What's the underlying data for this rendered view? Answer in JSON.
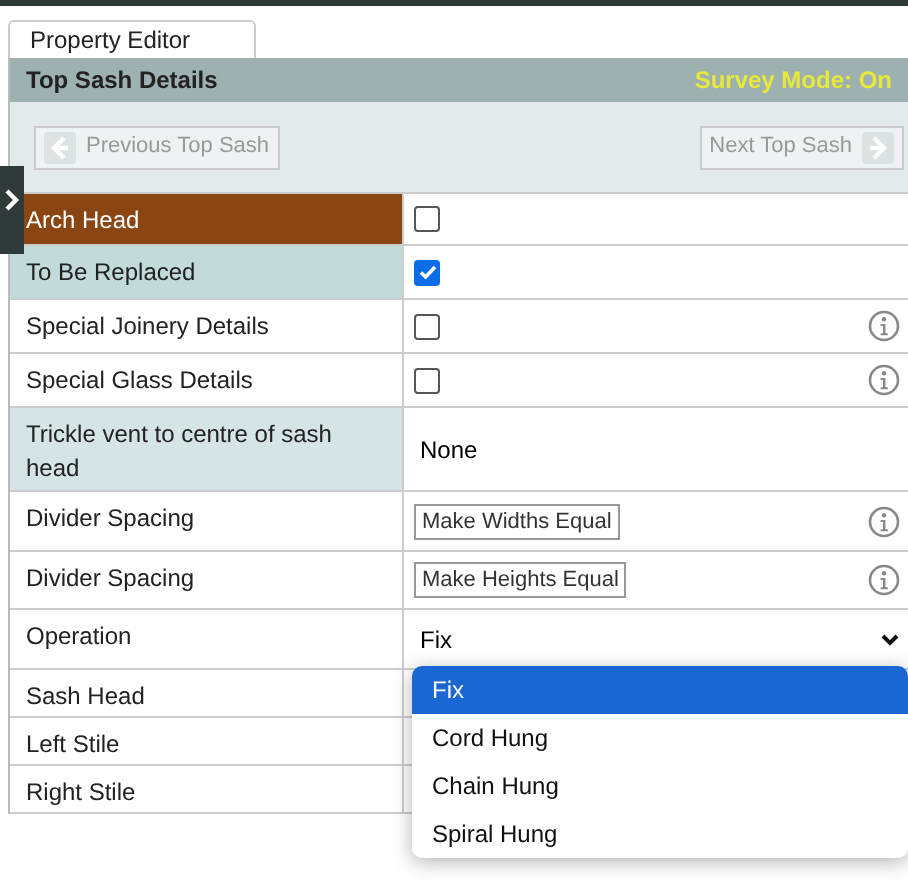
{
  "tab": {
    "label": "Property Editor",
    "selected": true
  },
  "header": {
    "title": "Top Sash Details",
    "mode": "Survey Mode: On"
  },
  "nav": {
    "previous": {
      "label": "Previous Top Sash",
      "disabled": true
    },
    "next": {
      "label": "Next Top Sash",
      "disabled": true
    }
  },
  "rows": [
    {
      "label": "Arch Head",
      "color": "#8b4513",
      "kind": "checkbox",
      "checked": false,
      "info": false
    },
    {
      "label": "To Be Replaced",
      "color": "#c2dada",
      "kind": "checkbox",
      "checked": true,
      "info": false
    },
    {
      "label": "Special Joinery Details",
      "color": "#ffffff",
      "kind": "checkbox",
      "checked": false,
      "info": true
    },
    {
      "label": "Special Glass Details",
      "color": "#ffffff",
      "kind": "checkbox",
      "checked": false,
      "info": true
    },
    {
      "label": "Trickle vent to centre of sash head",
      "color": "#d5e5e5",
      "kind": "text",
      "value": "None",
      "info": false
    },
    {
      "label": "Divider Spacing",
      "color": "#ffffff",
      "kind": "button",
      "value": "Make Widths Equal",
      "info": true
    },
    {
      "label": "Divider Spacing",
      "color": "#ffffff",
      "kind": "button",
      "value": "Make Heights Equal",
      "info": true
    },
    {
      "label": "Operation",
      "color": "#ffffff",
      "kind": "select",
      "value": "Fix",
      "info": false
    },
    {
      "label": "Sash Head",
      "color": "#ffffff",
      "kind": "hidden"
    },
    {
      "label": "Left Stile",
      "color": "#ffffff",
      "kind": "hidden"
    },
    {
      "label": "Right Stile",
      "color": "#ffffff",
      "kind": "hidden"
    }
  ],
  "dropdown": {
    "options": [
      {
        "label": "Fix",
        "selected": true
      },
      {
        "label": "Cord Hung",
        "selected": false
      },
      {
        "label": "Chain Hung",
        "selected": false
      },
      {
        "label": "Spiral Hung",
        "selected": false
      }
    ]
  }
}
